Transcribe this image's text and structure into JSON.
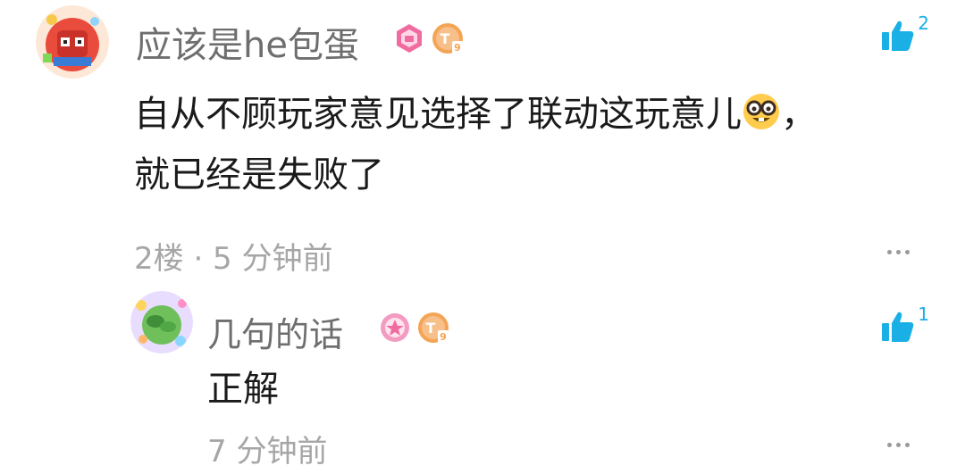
{
  "comments": [
    {
      "username": "应该是he包蛋",
      "content_line1": "自从不顾玩家意见选择了联动这玩意儿",
      "content_tail": "，",
      "content_line2": "就已经是失败了",
      "meta": "2楼 · 5 分钟前",
      "like_count": "2",
      "level_letter": "T",
      "level_num": "9"
    },
    {
      "username": "几句的话",
      "content": "正解",
      "meta": "7 分钟前",
      "like_count": "1",
      "level_letter": "T",
      "level_num": "9"
    }
  ],
  "colors": {
    "accent": "#1ab0e6",
    "username": "#6e6e6e",
    "meta": "#a6a6a6",
    "level_badge": "#f4a455",
    "cert_badge": "#f06ca0"
  },
  "icons": {
    "like": "thumbs-up-icon",
    "more": "more-horizontal-icon",
    "emoji": "nerd-face-emoji"
  }
}
